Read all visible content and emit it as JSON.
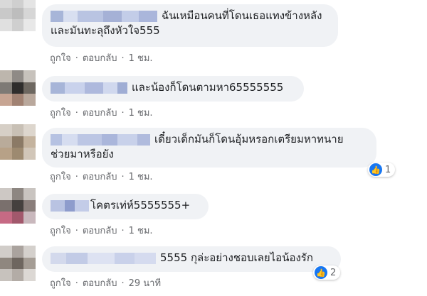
{
  "comments": [
    {
      "line1": "ฉันเหมือนคนที่โดนเธอแทงข้างหลัง",
      "line2": "และมันทะลุถึงหัวใจ555",
      "like": "ถูกใจ",
      "reply": "ตอบกลับ",
      "time": "1 ชม."
    },
    {
      "line1": "และน้องก็โดนตามหา65555555",
      "like": "ถูกใจ",
      "reply": "ตอบกลับ",
      "time": "1 ชม."
    },
    {
      "line1": "เดี๋ยวเด็กมันก็โดนอุ้มหรอกเตรียมหาทนาย",
      "line2": "ช่วยมาหรือยัง",
      "like": "ถูกใจ",
      "reply": "ตอบกลับ",
      "time": "1 ชม.",
      "reaction_count": "1"
    },
    {
      "line1": "โคตรเท่ห์5555555+",
      "like": "ถูกใจ",
      "reply": "ตอบกลับ",
      "time": "1 ชม."
    },
    {
      "line1": "5555 กุล่ะอย่างชอบเลยไอน้องรัก",
      "like": "ถูกใจ",
      "reply": "ตอบกลับ",
      "time": "29 นาที",
      "reaction_count": "2"
    }
  ],
  "separator": "·",
  "icons": {
    "reaction": "like-icon",
    "avatar": "blurred-avatar",
    "name": "blurred-name"
  },
  "colors": {
    "bubble": "#f0f2f5",
    "meta_text": "#65676b",
    "like_blue": "#1877f2"
  }
}
